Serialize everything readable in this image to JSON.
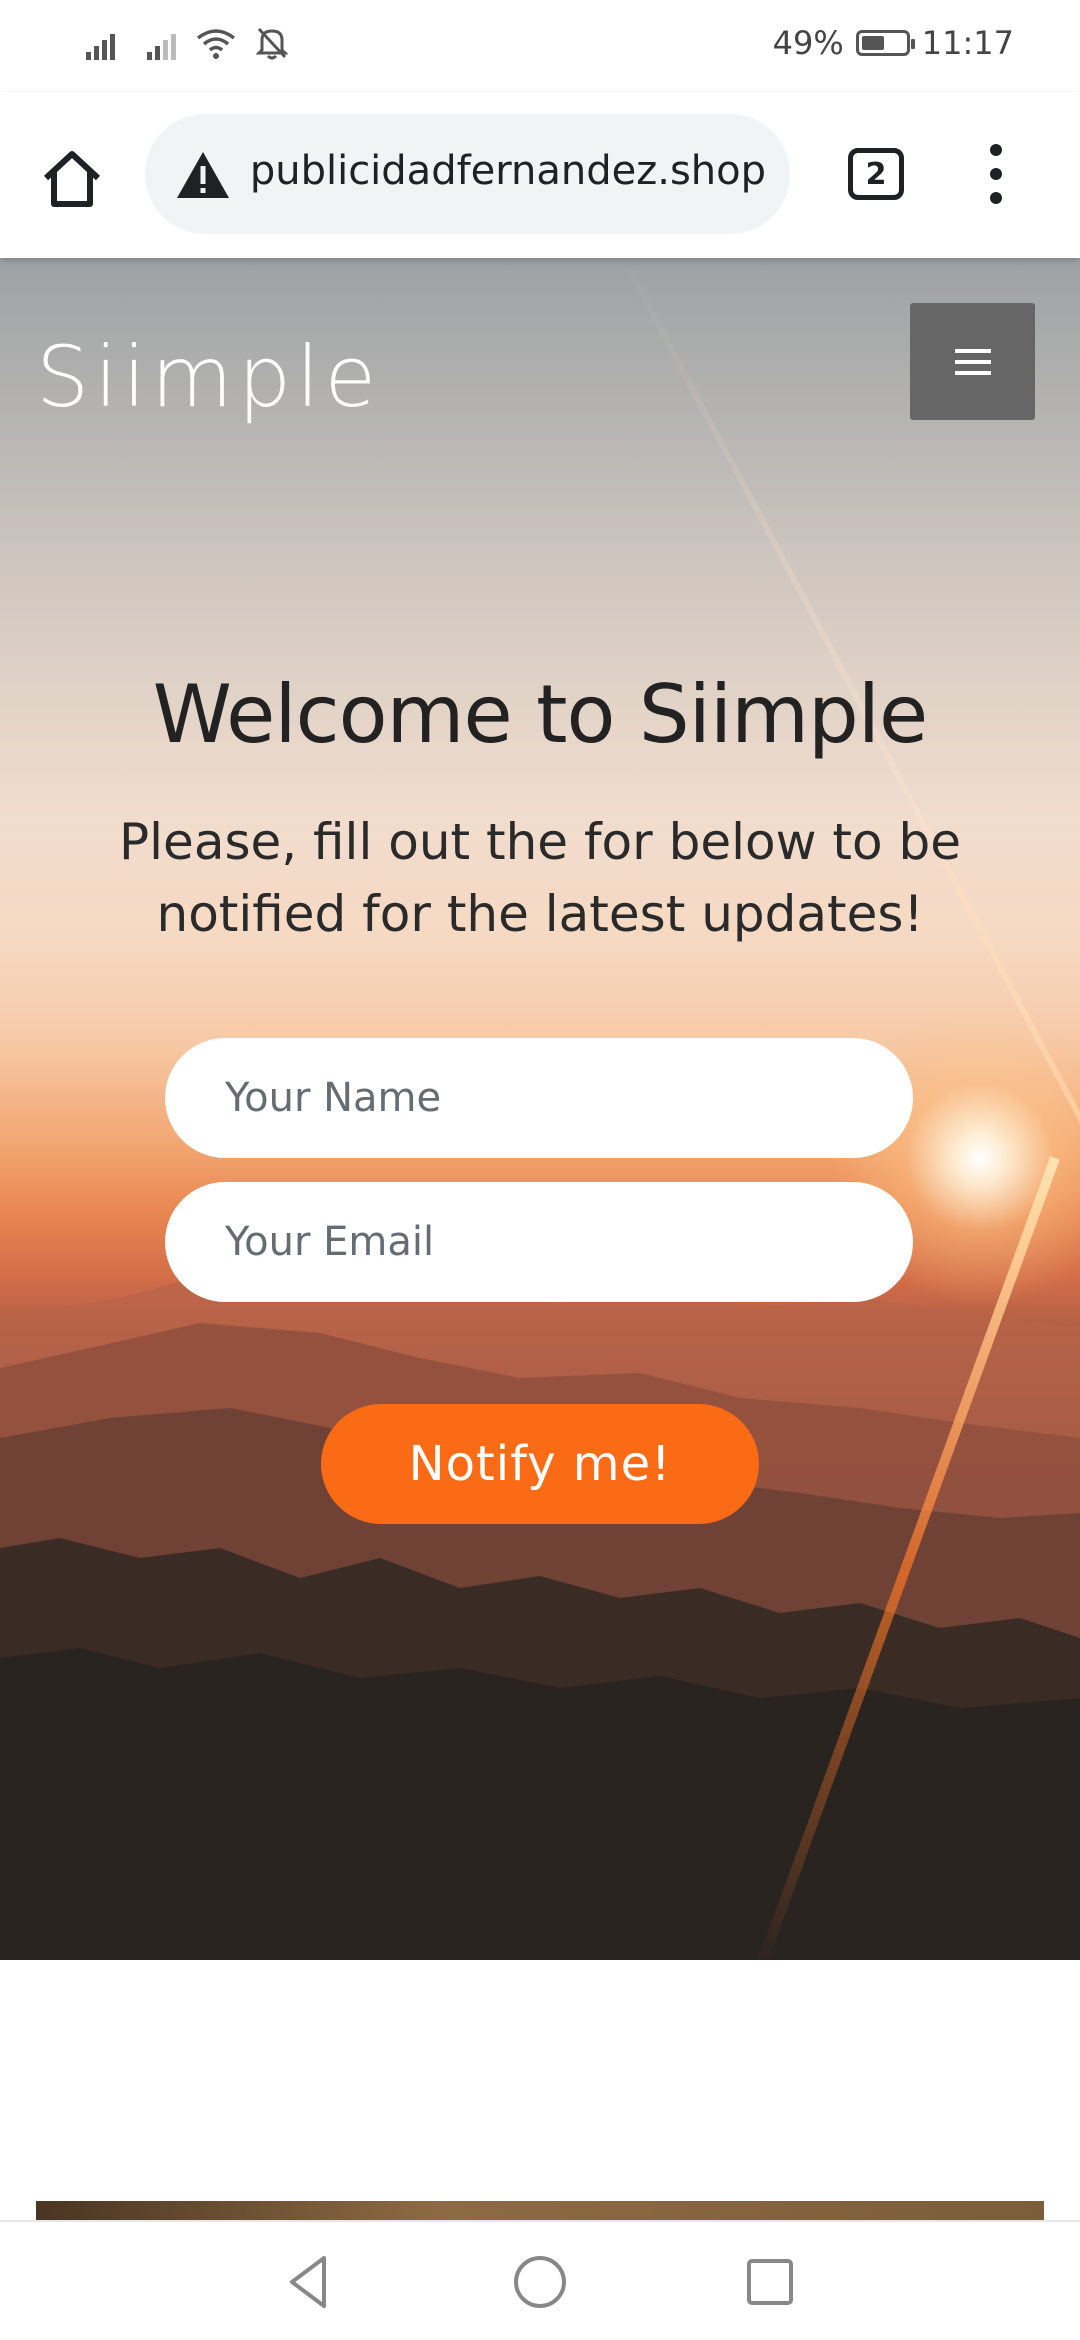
{
  "status_bar": {
    "battery_level": "49%",
    "battery_fraction": 0.49,
    "time": "11:17",
    "icons": [
      "signal-icon",
      "signal-icon",
      "wifi-icon",
      "notifications-off-icon",
      "battery-icon"
    ]
  },
  "browser": {
    "url": "publicidadfernandez.shop",
    "tab_count": "2",
    "icons": {
      "home": "home-icon",
      "security": "warning-icon",
      "menu": "more-vert-icon"
    }
  },
  "site": {
    "brand": "Siimple",
    "menu_icon": "hamburger-icon",
    "heading": "Welcome to Siimple",
    "subtitle": "Please, fill out the for below to be notified for the latest updates!",
    "form": {
      "name_placeholder": "Your Name",
      "email_placeholder": "Your Email",
      "submit_label": "Notify me!"
    },
    "colors": {
      "button": "#fb6b16",
      "menu_button": "#666666"
    }
  },
  "nav_bar": {
    "icons": [
      "back-icon",
      "home-circle-icon",
      "recents-icon"
    ]
  }
}
